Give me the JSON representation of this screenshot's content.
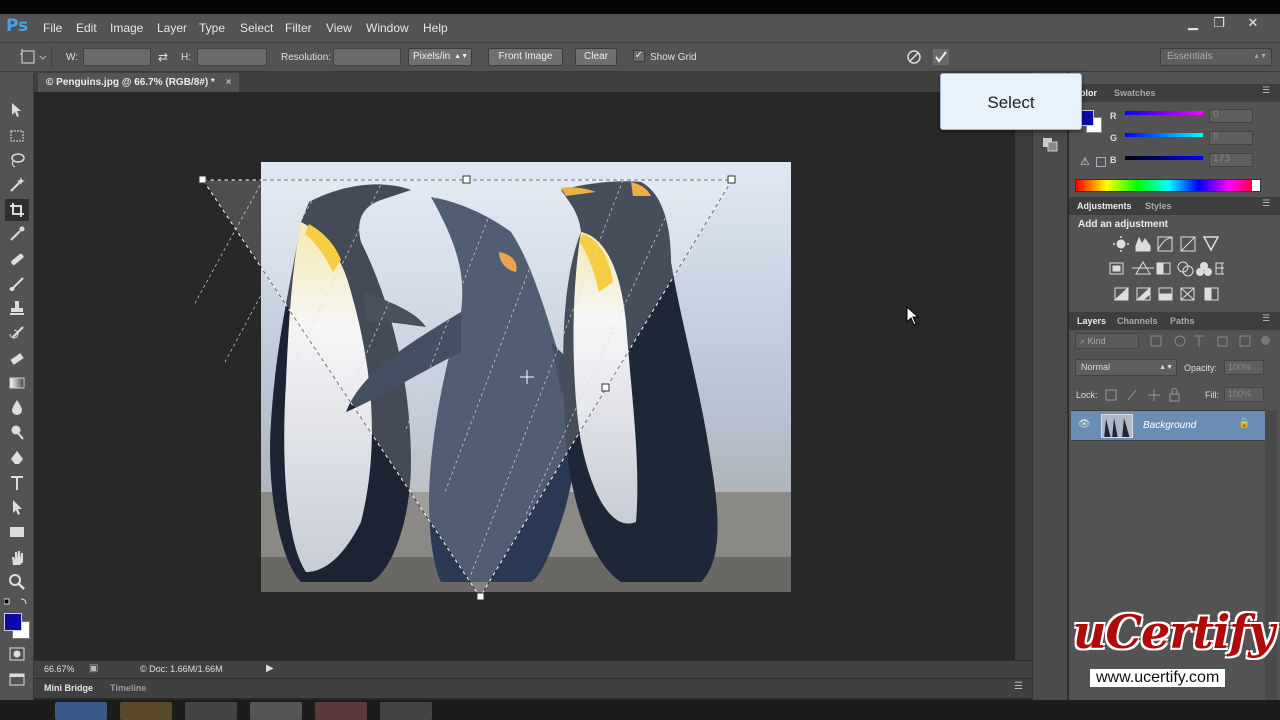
{
  "app": {
    "logo": "Ps"
  },
  "menu": [
    "File",
    "Edit",
    "Image",
    "Layer",
    "Type",
    "Select",
    "Filter",
    "View",
    "Window",
    "Help"
  ],
  "window_controls": {
    "minimize": "▁",
    "restore": "❐",
    "close": "✕"
  },
  "options": {
    "w_label": "W:",
    "h_label": "H:",
    "resolution_label": "Resolution:",
    "units": "Pixels/in",
    "front_image": "Front Image",
    "clear": "Clear",
    "show_grid": "Show Grid",
    "workspace": "Essentials"
  },
  "document": {
    "tab_title": "© Penguins.jpg @ 66.7% (RGB/8#) *",
    "zoom": "66.67%",
    "doc_info": "© Doc: 1.66M/1.66M"
  },
  "tooltip": {
    "text": "Select"
  },
  "color_panel": {
    "tab_color": "olor",
    "tab_swatches": "Swatches",
    "r_label": "R",
    "g_label": "G",
    "b_label": "B",
    "r_value": "0",
    "g_value": "0",
    "b_value": "173",
    "foreground": "#0a0aa8",
    "background": "#ffffff"
  },
  "adjustments_panel": {
    "tab_adjustments": "Adjustments",
    "tab_styles": "Styles",
    "heading": "Add an adjustment"
  },
  "layers_panel": {
    "tab_layers": "Layers",
    "tab_channels": "Channels",
    "tab_paths": "Paths",
    "kind": "Kind",
    "blend_mode": "Normal",
    "opacity_label": "Opacity:",
    "opacity_value": "100%",
    "lock_label": "Lock:",
    "fill_label": "Fill:",
    "fill_value": "100%",
    "layer_name": "Background"
  },
  "bottom_tabs": {
    "mini_bridge": "Mini Bridge",
    "timeline": "Timeline"
  },
  "watermark": {
    "title": "uCertify",
    "url": "www.ucertify.com"
  }
}
